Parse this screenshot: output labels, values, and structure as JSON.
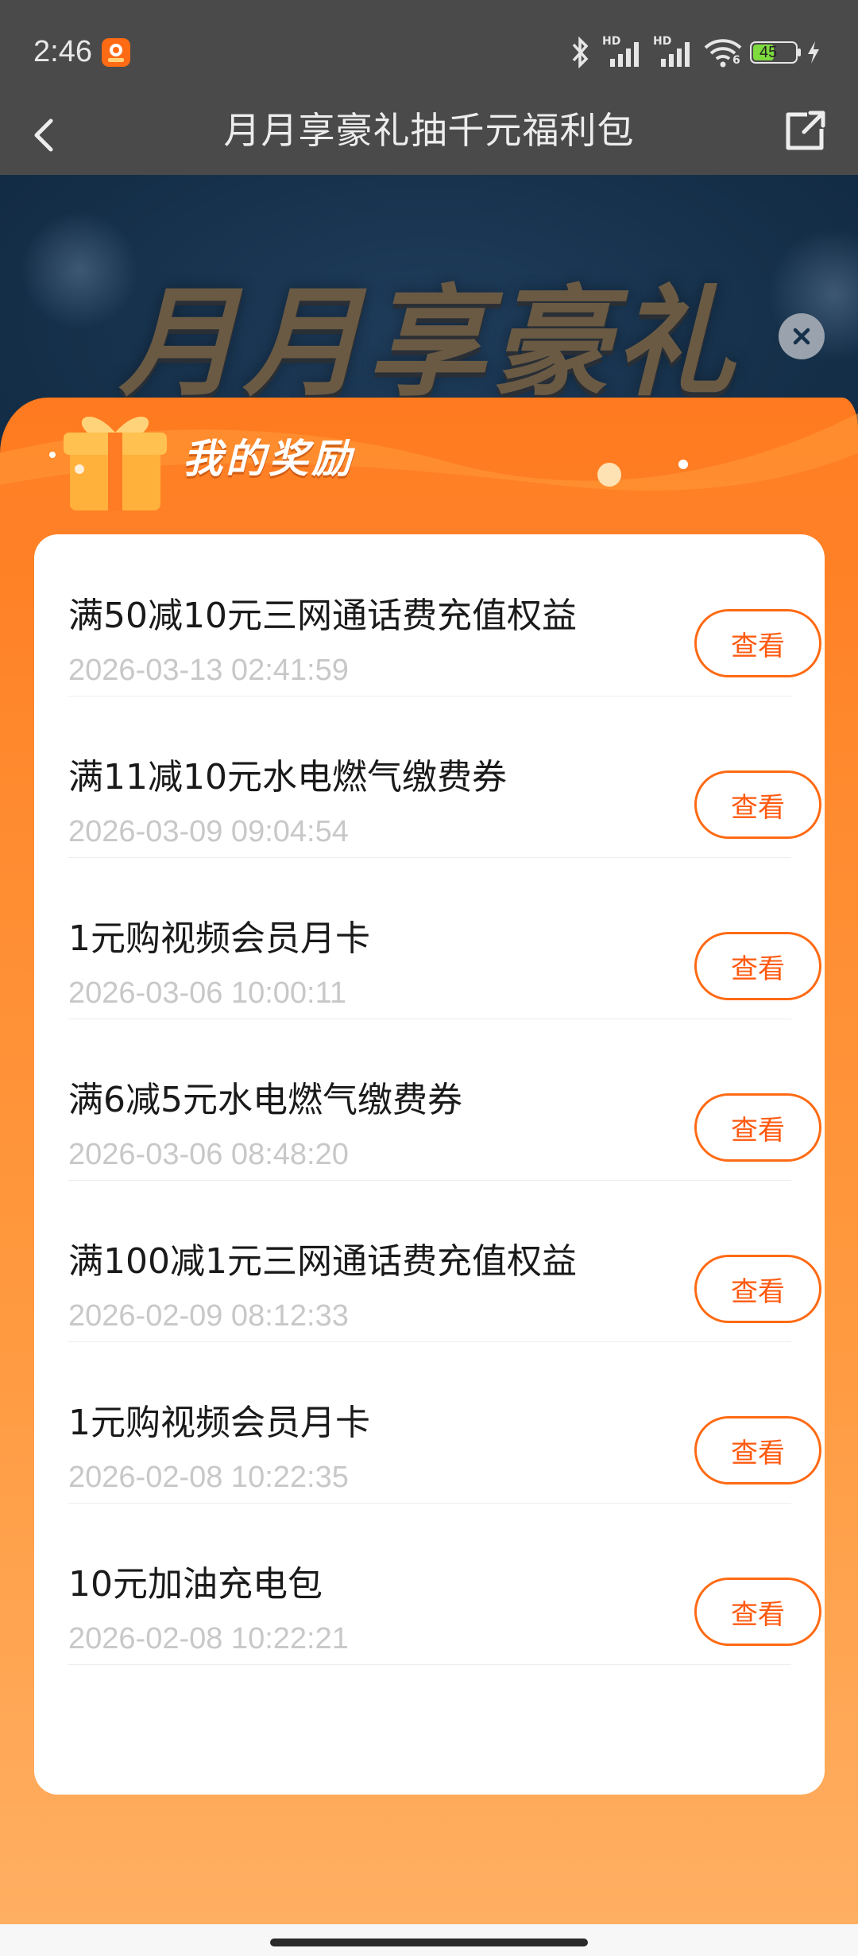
{
  "status_bar": {
    "time": "2:46",
    "battery": "45",
    "icons": [
      "app-notification-icon",
      "bluetooth-icon",
      "hd-signal-icon",
      "hd-signal-icon",
      "wifi-icon",
      "battery-icon",
      "charging-icon"
    ],
    "signal_label_1": "HD",
    "signal_label_2": "HD",
    "wifi_label": "6"
  },
  "nav": {
    "title": "月月享豪礼抽千元福利包",
    "back_icon": "chevron-left-icon",
    "share_icon": "external-share-icon"
  },
  "banner": {
    "title": "月月享豪礼",
    "close_icon": "close-icon"
  },
  "rewards": {
    "title": "我的奖励",
    "items": [
      {
        "title": "满50减10元三网通话费充值权益",
        "time": "2026-03-13 02:41:59",
        "button": "查看"
      },
      {
        "title": "满11减10元水电燃气缴费券",
        "time": "2026-03-09 09:04:54",
        "button": "查看"
      },
      {
        "title": "1元购视频会员月卡",
        "time": "2026-03-06 10:00:11",
        "button": "查看"
      },
      {
        "title": "满6减5元水电燃气缴费券",
        "time": "2026-03-06 08:48:20",
        "button": "查看"
      },
      {
        "title": "满100减1元三网通话费充值权益",
        "time": "2026-02-09 08:12:33",
        "button": "查看"
      },
      {
        "title": "1元购视频会员月卡",
        "time": "2026-02-08 10:22:35",
        "button": "查看"
      },
      {
        "title": "10元加油充电包",
        "time": "2026-02-08 10:22:21",
        "button": "查看"
      }
    ]
  },
  "colors": {
    "accent": "#ff6a14",
    "overlay": "#4a4a4a",
    "banner_bg": "#16314b",
    "orange_panel": "#ff8a2f"
  }
}
